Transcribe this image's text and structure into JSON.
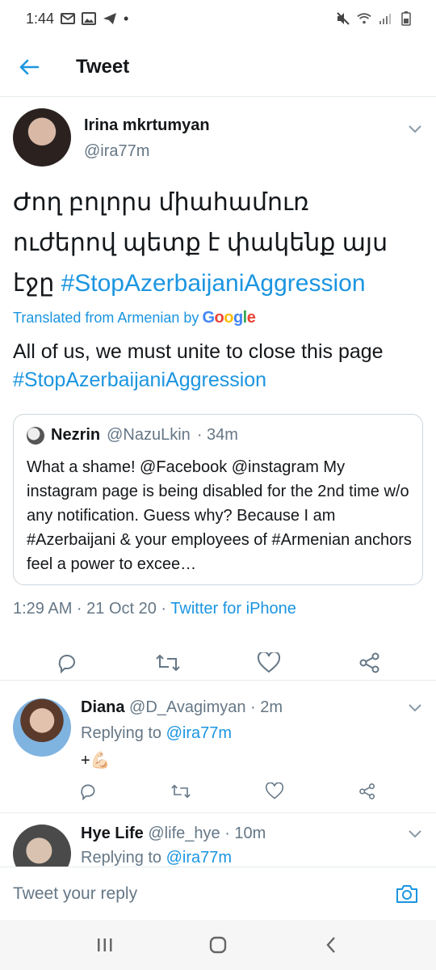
{
  "status_bar": {
    "time": "1:44",
    "dot": "•"
  },
  "header": {
    "title": "Tweet"
  },
  "tweet": {
    "author_name": "Irina mkrtumyan",
    "author_handle": "@ira77m",
    "text_line1": "Ժող բոլորս միահամուռ",
    "text_line2": "ուժերով պետք է փակենք այս",
    "text_line3_prefix": "էջը ",
    "hashtag": "#StopAzerbaijaniAggression",
    "translated_label": "Translated from Armenian by",
    "google_letters": [
      "G",
      "o",
      "o",
      "g",
      "l",
      "e"
    ],
    "translation_text": "All of us, we must unite to close this page",
    "translation_hashtag": "#StopAzerbaijaniAggression",
    "timestamp": "1:29 AM · 21 Oct 20 · ",
    "source": "Twitter for iPhone"
  },
  "quote": {
    "name": "Nezrin",
    "handle": "@NazuLkin",
    "age": "· 34m",
    "text": "What a shame! @Facebook @instagram My instagram page is being disabled for the 2nd time w/o any notification. Guess why? Because I am #Azerbaijani & your employees of #Armenian anchors feel a power to excee…"
  },
  "replies": [
    {
      "name": "Diana",
      "handle": "@D_Avagimyan",
      "age": "· 2m",
      "replying_label": "Replying to ",
      "replying_to": "@ira77m",
      "body": "+💪🏻"
    },
    {
      "name": "Hye Life",
      "handle": "@life_hye",
      "age": "· 10m",
      "replying_label": "Replying to ",
      "replying_to": "@ira77m"
    }
  ],
  "compose": {
    "placeholder": "Tweet your reply"
  },
  "colors": {
    "accent": "#1b95e0",
    "muted": "#657786",
    "text": "#14171a",
    "border": "#e6ecf0"
  },
  "icons": [
    "back-arrow-icon",
    "chevron-down-icon",
    "reply-icon",
    "retweet-icon",
    "like-icon",
    "share-icon",
    "camera-icon"
  ]
}
